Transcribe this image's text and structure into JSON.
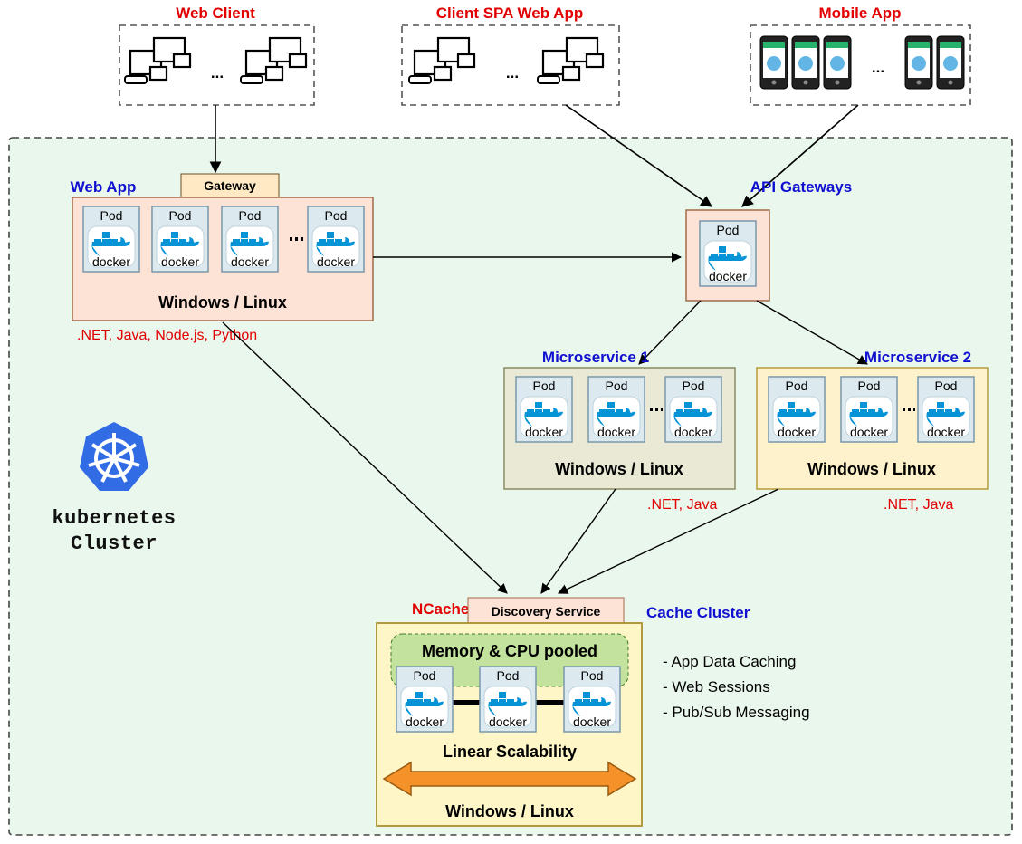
{
  "clients": {
    "webClient": "Web Client",
    "spa": "Client SPA Web App",
    "mobile": "Mobile App",
    "ellipsis": "..."
  },
  "cluster": {
    "kubeWord": "kubernetes",
    "clusterWord": "Cluster"
  },
  "webApp": {
    "title": "Web App",
    "gateway": "Gateway",
    "pod": "Pod",
    "os": "Windows /  Linux",
    "langs": ".NET, Java, Node.js, Python"
  },
  "apiGw": {
    "title": "API Gateways",
    "pod": "Pod"
  },
  "ms1": {
    "title": "Microservice 1",
    "pod": "Pod",
    "os": "Windows /  Linux",
    "langs": ".NET, Java"
  },
  "ms2": {
    "title": "Microservice 2",
    "pod": "Pod",
    "os": "Windows /  Linux",
    "langs": ".NET, Java"
  },
  "ncache": {
    "brand": "NCache",
    "discovery": "Discovery Service",
    "cacheCluster": "Cache Cluster",
    "pool": "Memory & CPU pooled",
    "pod": "Pod",
    "scale": "Linear Scalability",
    "os": "Windows /  Linux",
    "features": {
      "f1": "- App Data Caching",
      "f2": "- Web Sessions",
      "f3": "- Pub/Sub Messaging"
    }
  },
  "docker": {
    "word": "docker"
  }
}
